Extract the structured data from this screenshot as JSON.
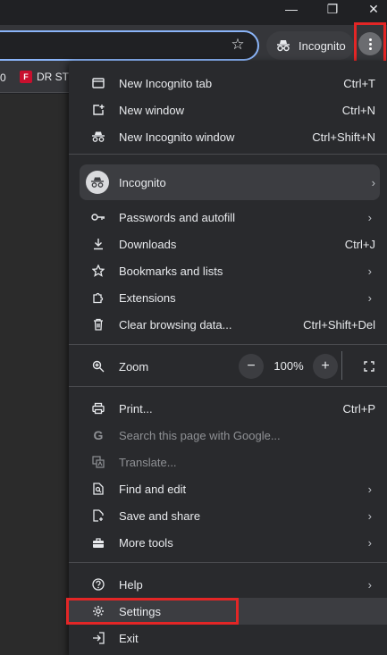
{
  "window": {
    "minimize_label": "—",
    "restore_label": "❐",
    "close_label": "✕"
  },
  "toolbar": {
    "bookmark_star": "☆",
    "incognito_label": "Incognito"
  },
  "bookmarks_bar": {
    "left_fragment": "0",
    "item_label": "DR STI",
    "item_icon_text": "F"
  },
  "menu": {
    "items_top": [
      {
        "label": "New Incognito tab",
        "shortcut": "Ctrl+T",
        "icon": "new-tab-icon"
      },
      {
        "label": "New window",
        "shortcut": "Ctrl+N",
        "icon": "new-window-icon"
      },
      {
        "label": "New Incognito window",
        "shortcut": "Ctrl+Shift+N",
        "icon": "incognito-icon"
      }
    ],
    "profile": {
      "label": "Incognito",
      "chevron": "›"
    },
    "items_mid": [
      {
        "label": "Passwords and autofill",
        "chevron": "›",
        "icon": "key-icon"
      },
      {
        "label": "Downloads",
        "shortcut": "Ctrl+J",
        "icon": "download-icon"
      },
      {
        "label": "Bookmarks and lists",
        "chevron": "›",
        "icon": "star-icon"
      },
      {
        "label": "Extensions",
        "chevron": "›",
        "icon": "puzzle-icon"
      },
      {
        "label": "Clear browsing data...",
        "shortcut": "Ctrl+Shift+Del",
        "icon": "trash-icon"
      }
    ],
    "zoom": {
      "label": "Zoom",
      "minus": "−",
      "value": "100%",
      "plus": "+"
    },
    "items_tools": [
      {
        "label": "Print...",
        "shortcut": "Ctrl+P",
        "icon": "print-icon"
      },
      {
        "label": "Search this page with Google...",
        "icon": "google-icon",
        "disabled": true
      },
      {
        "label": "Translate...",
        "icon": "translate-icon",
        "disabled": true
      },
      {
        "label": "Find and edit",
        "chevron": "›",
        "icon": "find-icon"
      },
      {
        "label": "Save and share",
        "chevron": "›",
        "icon": "save-icon"
      },
      {
        "label": "More tools",
        "chevron": "›",
        "icon": "toolbox-icon"
      }
    ],
    "items_bottom": [
      {
        "label": "Help",
        "chevron": "›",
        "icon": "help-icon"
      },
      {
        "label": "Settings",
        "icon": "gear-icon"
      },
      {
        "label": "Exit",
        "icon": "exit-icon"
      }
    ]
  },
  "colors": {
    "highlight": "#e32626",
    "menu_bg": "#292a2d",
    "focus_ring": "#8ab4f8"
  }
}
